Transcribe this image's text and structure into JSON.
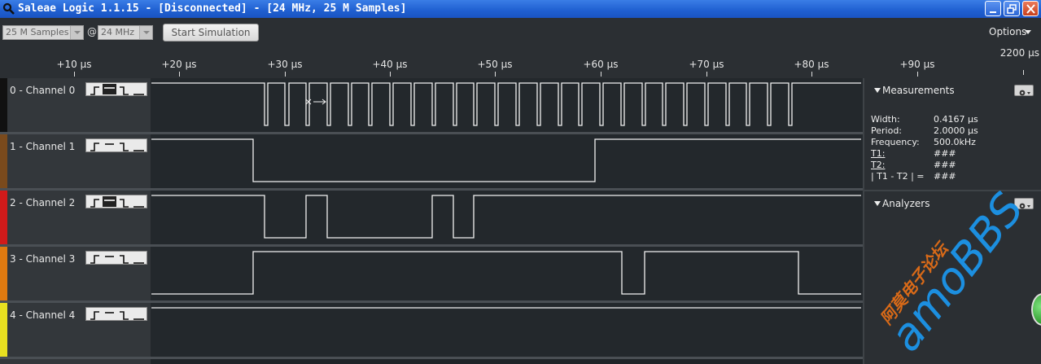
{
  "window": {
    "title": "Saleae Logic 1.1.15 - [Disconnected] - [24 MHz, 25 M Samples]"
  },
  "toolbar": {
    "samples": "25 M Samples",
    "at": "@",
    "rate": "24 MHz",
    "start_label": "Start Simulation",
    "options_label": "Options"
  },
  "ruler": {
    "ticks": [
      "+10 µs",
      "+20 µs",
      "+30 µs",
      "+40 µs",
      "+50 µs",
      "+60 µs",
      "+70 µs",
      "+80 µs",
      "+90 µs"
    ],
    "zoom_label": "2200 µs"
  },
  "channels": [
    {
      "name": "0 - Channel 0",
      "color": "#111111"
    },
    {
      "name": "1 - Channel 1",
      "color": "#7a4a1c"
    },
    {
      "name": "2 - Channel 2",
      "color": "#d11a1a"
    },
    {
      "name": "3 - Channel 3",
      "color": "#e07a10"
    },
    {
      "name": "4 - Channel 4",
      "color": "#e8e020"
    }
  ],
  "measurements": {
    "title": "Measurements",
    "rows": [
      {
        "label": "Width:",
        "value": "0.4167 µs"
      },
      {
        "label": "Period:",
        "value": "2.0000 µs"
      },
      {
        "label": "Frequency:",
        "value": "500.0kHz"
      },
      {
        "label": "T1:",
        "value": "###"
      },
      {
        "label": "T2:",
        "value": "###"
      },
      {
        "label": "| T1 - T2 | =",
        "value": "###"
      }
    ]
  },
  "analyzers": {
    "title": "Analyzers"
  },
  "watermark": {
    "brand": "amoBBS",
    "cn": "阿莫电子论坛"
  }
}
